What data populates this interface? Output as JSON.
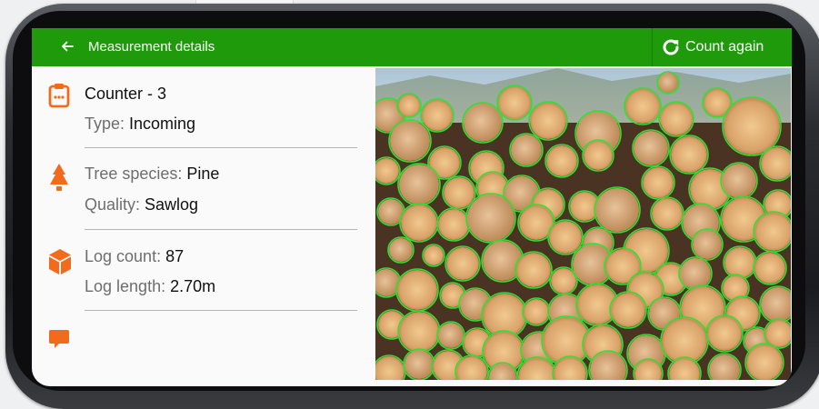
{
  "app_bar": {
    "title": "Measurement details",
    "count_again_label": "Count again",
    "background": "#1e9a0b"
  },
  "details": {
    "counter": {
      "icon": "clipboard-icon",
      "title": "Counter - 3",
      "type_label": "Type: ",
      "type_value": "Incoming"
    },
    "species": {
      "icon": "tree-icon",
      "species_label": "Tree species: ",
      "species_value": "Pine",
      "quality_label": "Quality: ",
      "quality_value": "Sawlog"
    },
    "logs": {
      "icon": "cube-icon",
      "count_label": "Log count: ",
      "count_value": "87",
      "length_label": "Log length: ",
      "length_value": "2.70m"
    },
    "comment": {
      "icon": "comment-icon"
    },
    "accent_color": "#f26a1b"
  },
  "photo": {
    "description_alt": "Log pile",
    "detection_color": "#2fe02f"
  }
}
